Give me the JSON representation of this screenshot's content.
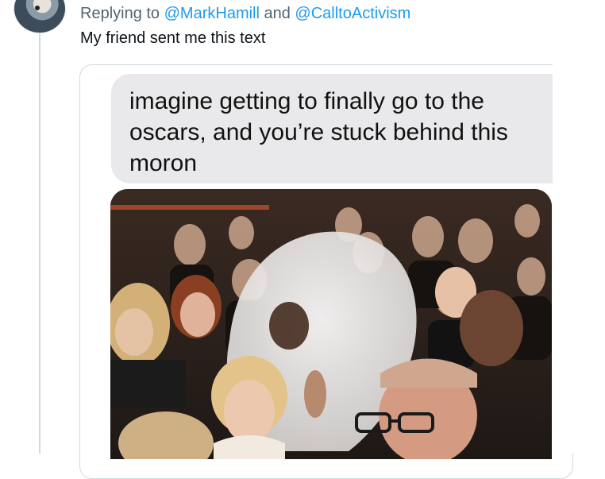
{
  "reply": {
    "prefix": "Replying to ",
    "mention1": "@MarkHamill",
    "and": " and ",
    "mention2": "@CalltoActivism"
  },
  "tweet": {
    "text": "My friend sent me this text"
  },
  "message": {
    "text": "imagine getting to finally go to the oscars, and you’re stuck behind this moron"
  },
  "colors": {
    "mention": "#1d9bf0",
    "secondary_text": "#536471",
    "bubble": "#e9e9eb",
    "border": "#cfd9de"
  }
}
